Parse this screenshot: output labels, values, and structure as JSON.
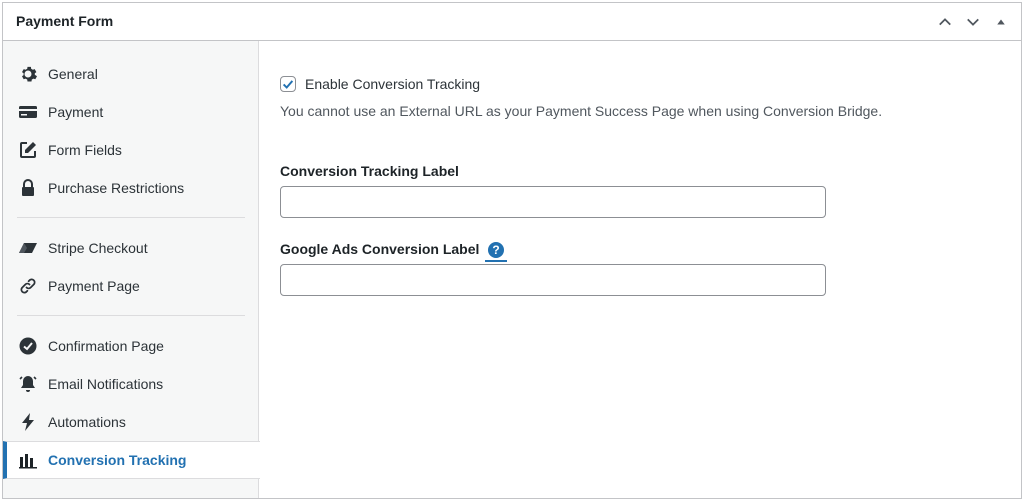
{
  "panel": {
    "title": "Payment Form"
  },
  "header_controls": {
    "move_up_icon": "chevron-up-icon",
    "move_down_icon": "chevron-down-icon",
    "toggle_icon": "triangle-up-icon"
  },
  "sidebar": {
    "items": [
      {
        "label": "General",
        "icon": "gear-icon"
      },
      {
        "label": "Payment",
        "icon": "credit-card-icon"
      },
      {
        "label": "Form Fields",
        "icon": "edit-icon"
      },
      {
        "label": "Purchase Restrictions",
        "icon": "lock-icon"
      },
      {
        "label": "Stripe Checkout",
        "icon": "stripe-icon"
      },
      {
        "label": "Payment Page",
        "icon": "link-icon"
      },
      {
        "label": "Confirmation Page",
        "icon": "check-circle-icon"
      },
      {
        "label": "Email Notifications",
        "icon": "bell-icon"
      },
      {
        "label": "Automations",
        "icon": "bolt-icon"
      },
      {
        "label": "Conversion Tracking",
        "icon": "bar-chart-icon",
        "active": true
      }
    ]
  },
  "content": {
    "enable_tracking": {
      "label": "Enable Conversion Tracking",
      "checked": true
    },
    "help_text": "You cannot use an External URL as your Payment Success Page when using Conversion Bridge.",
    "tracking_label": {
      "label": "Conversion Tracking Label",
      "value": "",
      "placeholder": ""
    },
    "ads_label": {
      "label": "Google Ads Conversion Label",
      "value": "",
      "placeholder": "",
      "help_icon": "question-circle-icon",
      "help_glyph": "?"
    }
  },
  "colors": {
    "accent": "#2271b1",
    "sidebar_bg": "#f6f7f7",
    "border": "#c3c4c7"
  }
}
